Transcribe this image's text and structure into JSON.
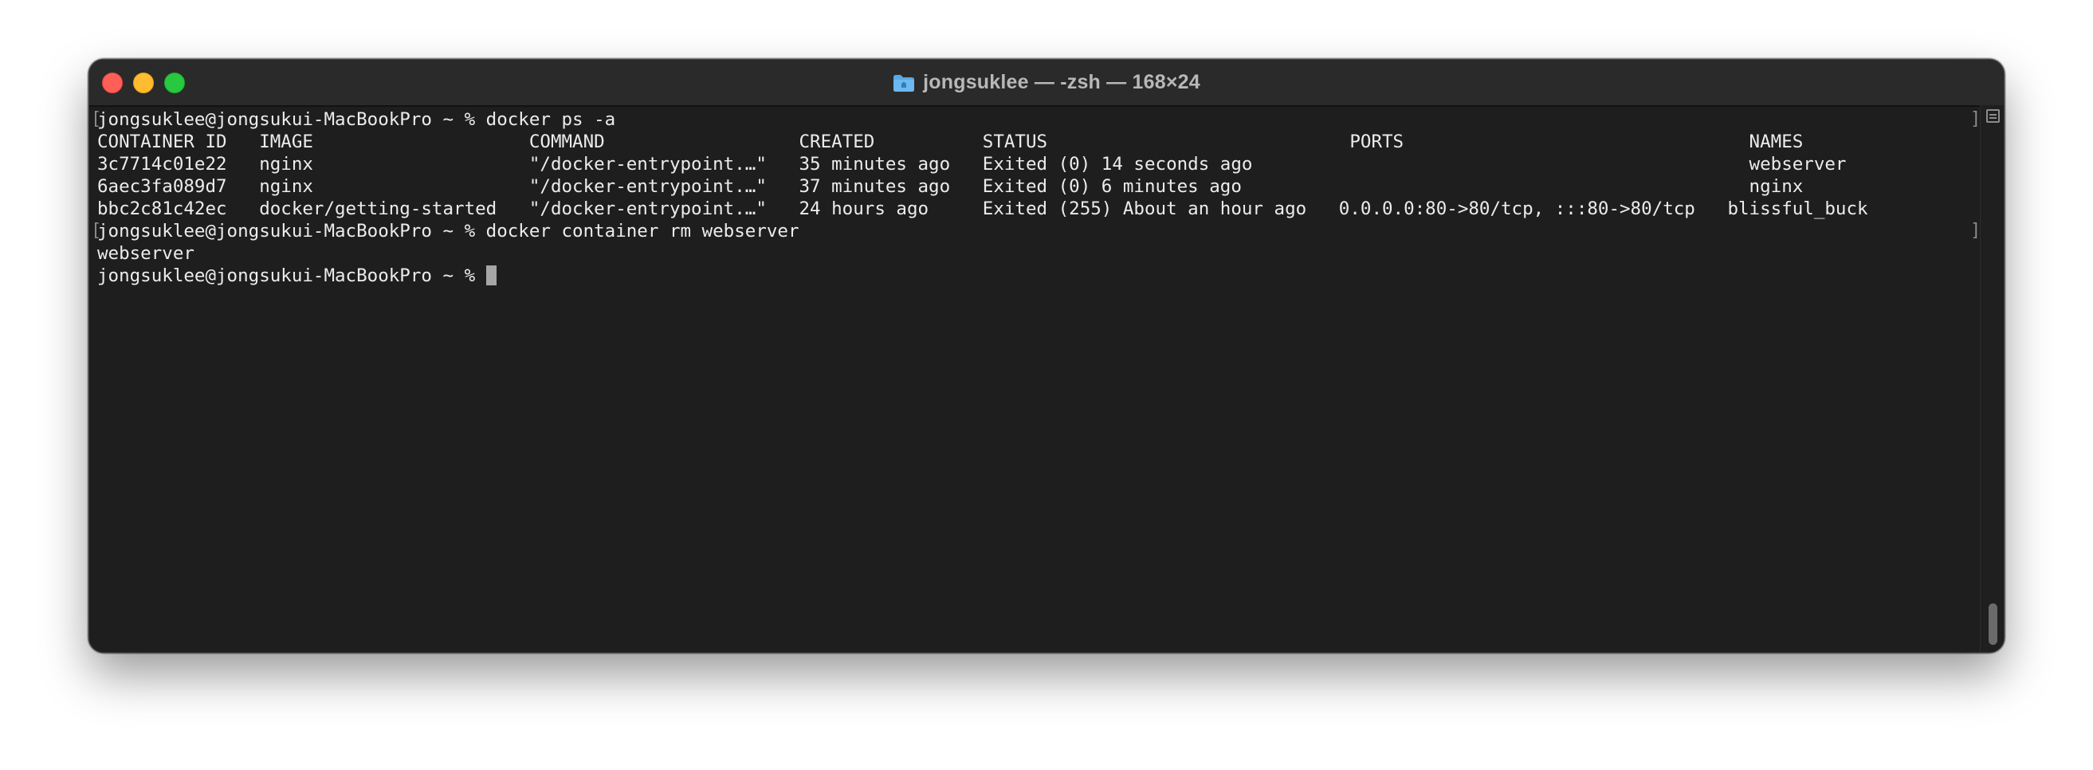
{
  "window": {
    "title": "jongsuklee — -zsh — 168×24"
  },
  "terminal": {
    "lines": [
      "jongsuklee@jongsukui-MacBookPro ~ % docker ps -a",
      "CONTAINER ID   IMAGE                    COMMAND                  CREATED          STATUS                            PORTS                                NAMES",
      "3c7714c01e22   nginx                    \"/docker-entrypoint.…\"   35 minutes ago   Exited (0) 14 seconds ago                                              webserver",
      "6aec3fa089d7   nginx                    \"/docker-entrypoint.…\"   37 minutes ago   Exited (0) 6 minutes ago                                               nginx",
      "bbc2c81c42ec   docker/getting-started   \"/docker-entrypoint.…\"   24 hours ago     Exited (255) About an hour ago   0.0.0.0:80->80/tcp, :::80->80/tcp   blissful_buck",
      "jongsuklee@jongsukui-MacBookPro ~ % docker container rm webserver",
      "webserver"
    ],
    "prompt": "jongsuklee@jongsukui-MacBookPro ~ % "
  },
  "icons": {
    "title_icon": "folder-icon",
    "split_icon": "split-pane-icon"
  },
  "colors": {
    "close": "#ff5f57",
    "minimize": "#febc2e",
    "maximize": "#28c840",
    "terminal_bg": "#1e1e1e",
    "text": "#ececec"
  }
}
